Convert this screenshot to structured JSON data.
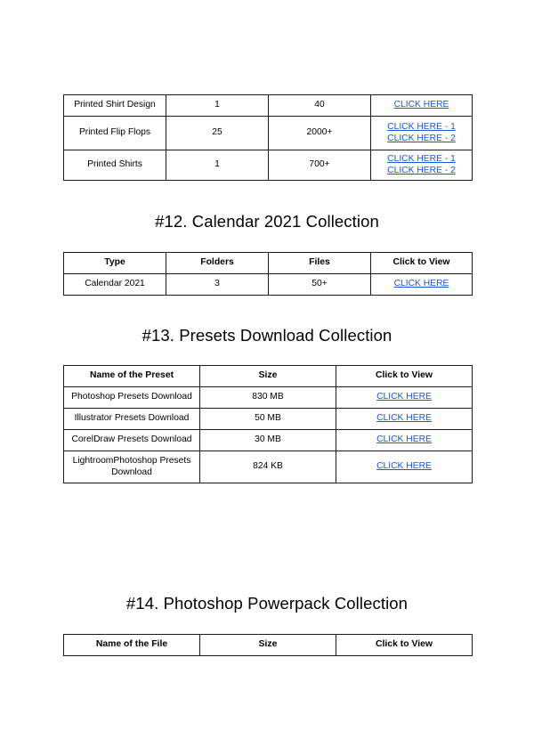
{
  "page": {
    "background_color": "#ffffff",
    "text_color": "#000000",
    "link_color": "#1558d6",
    "border_color": "#1a1a1a"
  },
  "printed_tail_table": {
    "rows": [
      {
        "name": "Printed Shirt Design",
        "folders": "1",
        "files": "40",
        "links": [
          "CLICK HERE"
        ]
      },
      {
        "name": "Printed Flip Flops",
        "folders": "25",
        "files": "2000+",
        "links": [
          "CLICK HERE - 1",
          "CLICK HERE - 2"
        ]
      },
      {
        "name": "Printed Shirts",
        "folders": "1",
        "files": "700+",
        "links": [
          "CLICK HERE - 1",
          "CLICK HERE - 2"
        ]
      }
    ]
  },
  "calendar_section": {
    "heading": "#12. Calendar 2021 Collection",
    "headers": [
      "Type",
      "Folders",
      "Files",
      "Click to View"
    ],
    "rows": [
      {
        "type": "Calendar 2021",
        "folders": "3",
        "files": "50+",
        "link": "CLICK HERE"
      }
    ]
  },
  "presets_section": {
    "heading": "#13. Presets Download Collection",
    "headers": [
      "Name of the Preset",
      "Size",
      "Click to View"
    ],
    "rows": [
      {
        "name": "Photoshop Presets Download",
        "size": "830 MB",
        "link": "CLICK HERE"
      },
      {
        "name": "Illustrator Presets Download",
        "size": "50 MB",
        "link": "CLICK HERE"
      },
      {
        "name": "CorelDraw Presets Download",
        "size": "30 MB",
        "link": "CLICK HERE"
      },
      {
        "name": "LightroomPhotoshop Presets Download",
        "size": "824 KB",
        "link": "CLICK HERE"
      }
    ]
  },
  "powerpack_section": {
    "heading": "#14. Photoshop Powerpack Collection",
    "headers": [
      "Name of the File",
      "Size",
      "Click to View"
    ],
    "rows": []
  }
}
